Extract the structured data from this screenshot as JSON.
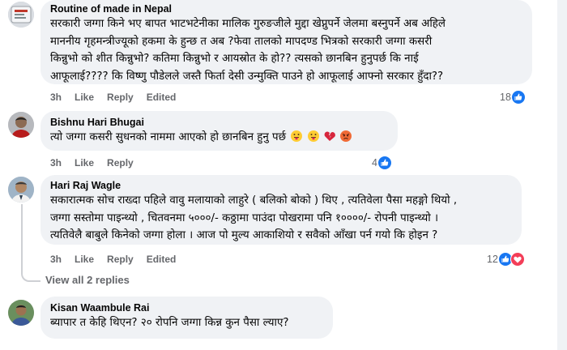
{
  "comments": [
    {
      "author": "Routine of made in Nepal",
      "lines": [
        "सरकारी जग्गा किने भए बापत भाटभटेनीका मालिक गुरुङजीले मुद्दा खेप्नुपर्ने जेलमा बस्नुपर्ने अब अहिले",
        "माननीय गृहमन्त्रीज्यूको हकमा के हुन्छ त अब ?फेवा तालको मापदण्ड भित्रको सरकारी जग्गा कसरी",
        "किन्नुभो को शीत किन्नुभो? कतिमा किन्नुभो र आयस्रोत के हो?? त्यसको छानबिन हुनुपर्छ कि नाई",
        "आफूलाई???? कि विष्णु पौडेलले जस्तै फिर्ता देसी उन्मुक्ति पाउने हो आफूलाई आफ्नो सरकार हुँदा??"
      ],
      "actions": [
        "3h",
        "Like",
        "Reply",
        "Edited"
      ],
      "reaction_count": "18",
      "reaction_icons": [
        "like-icon"
      ]
    },
    {
      "author": "Bishnu Hari Bhugai",
      "lines": [
        "त्यो जग्गा कसरी सुधनको नाममा आएको हो छानबिन हुनु पर्छ"
      ],
      "inline_emojis": [
        "tongue-emoji-icon",
        "tongue-emoji-icon",
        "broken-heart-icon",
        "angry-emoji-icon"
      ],
      "actions": [
        "3h",
        "Like",
        "Reply"
      ],
      "reaction_count": "4",
      "reaction_icons": [
        "like-icon"
      ]
    },
    {
      "author": "Hari Raj Wagle",
      "lines": [
        "सकारात्मक सोच राख्दा पहिले वावु मलायाको लाहुरे ( बलिको बोको ) थिए , त्यतिवेला पैसा महङ्गो थियो ,",
        "जग्गा सस्तोमा पाइन्थ्यो , चितवनमा ५०००/- कठ्ठामा पाउंदा पोखरामा पनि १००००/- रोपनी पाइन्थ्यो ।",
        "त्यतिवेलै बाबुले किनेको जग्गा होला । आज पो मुल्य आकाशियो र सवैको आँखा पर्न गयो कि होइन ?"
      ],
      "actions": [
        "3h",
        "Like",
        "Reply",
        "Edited"
      ],
      "reaction_count": "12",
      "reaction_icons": [
        "like-icon",
        "love-icon"
      ]
    },
    {
      "author": "Kisan Waambule Rai",
      "lines": [
        "ब्यापार त केहि थिएन? २० रोपनि जग्गा किन्न कुन पैसा ल्याए?"
      ]
    }
  ],
  "view_replies": "View all 2 replies",
  "colors": {
    "bubble": "#f0f2f5",
    "action_text": "#65676b",
    "like_blue": "#1877f2",
    "love_red": "#f33e58"
  }
}
